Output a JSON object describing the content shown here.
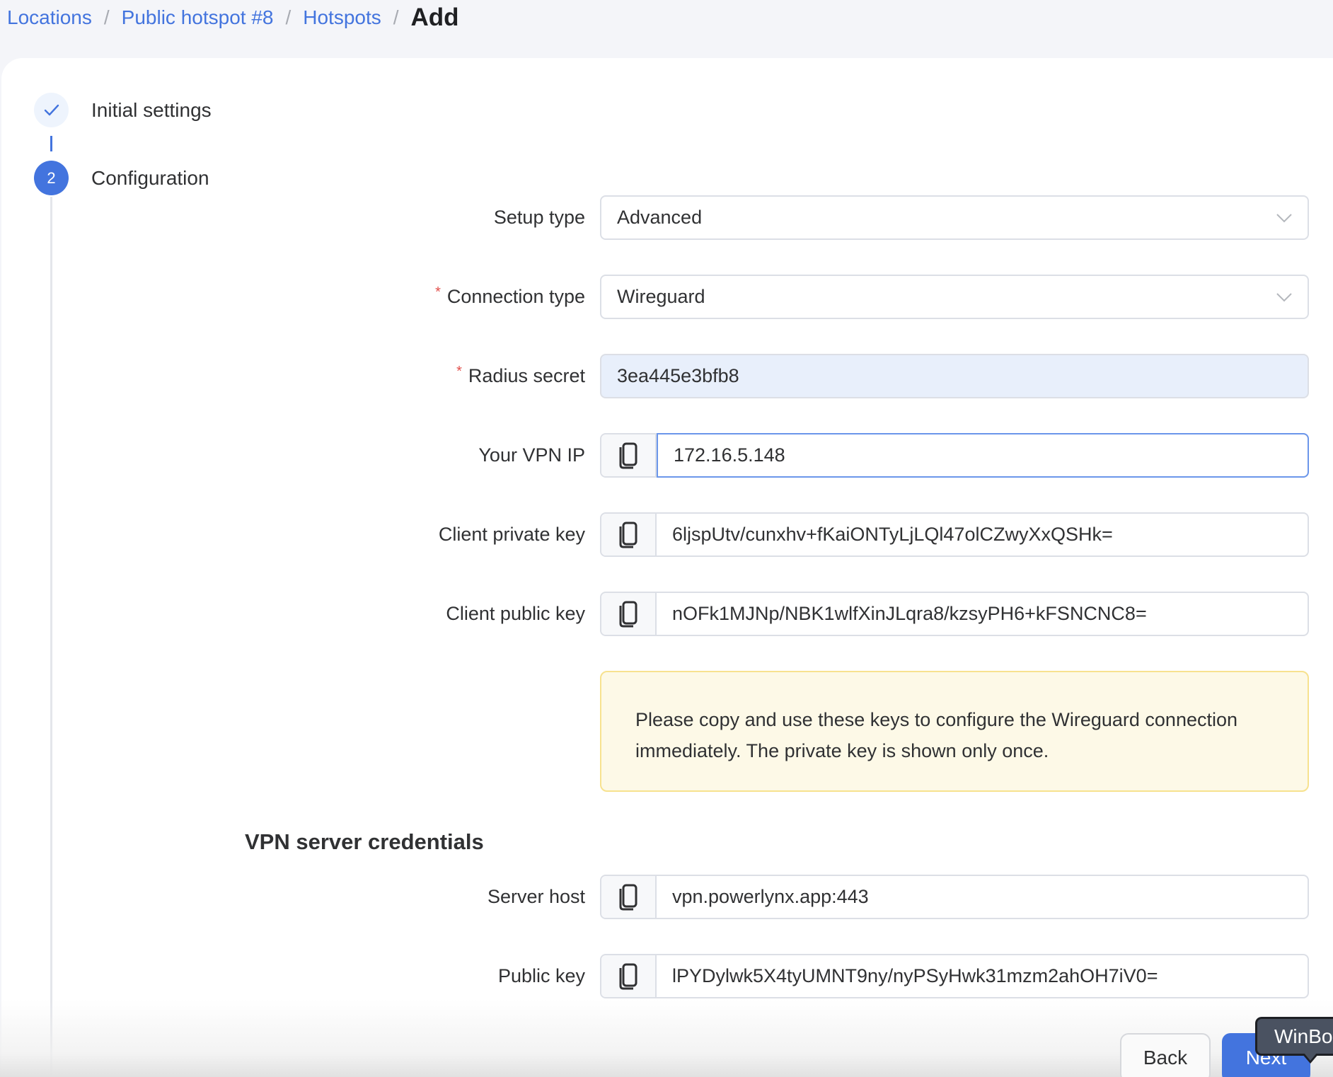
{
  "breadcrumb": {
    "items": [
      "Locations",
      "Public hotspot #8",
      "Hotspots"
    ],
    "separator": "/",
    "current": "Add"
  },
  "stepper": {
    "steps": [
      {
        "label": "Initial settings",
        "status": "done",
        "icon": "check-icon"
      },
      {
        "label": "Configuration",
        "status": "active",
        "number": "2"
      }
    ]
  },
  "form": {
    "setup_type": {
      "label": "Setup type",
      "value": "Advanced",
      "required": false
    },
    "connection_type": {
      "label": "Connection type",
      "value": "Wireguard",
      "required": true
    },
    "radius_secret": {
      "label": "Radius secret",
      "value": "3ea445e3bfb8",
      "required": true
    },
    "vpn_ip": {
      "label": "Your VPN IP",
      "value": "172.16.5.148",
      "focused": true
    },
    "client_private_key": {
      "label": "Client private key",
      "value": "6ljspUtv/cunxhv+fKaiONTyLjLQl47olCZwyXxQSHk="
    },
    "client_public_key": {
      "label": "Client public key",
      "value": "nOFk1MJNp/NBK1wlfXinJLqra8/kzsyPH6+kFSNCNC8="
    },
    "required_marker": "*",
    "copy_icon": "copy-icon"
  },
  "notice": {
    "text": "Please copy and use these keys to configure the Wireguard connection immediately. The private key is shown only once."
  },
  "server_credentials": {
    "title": "VPN server credentials",
    "server_host": {
      "label": "Server host",
      "value": "vpn.powerlynx.app:443"
    },
    "public_key": {
      "label": "Public key",
      "value": "lPYDylwk5X4tyUMNT9ny/nyPSyHwk31mzm2ahOH7iV0="
    }
  },
  "actions": {
    "back_label": "Back",
    "next_label": "Next"
  },
  "tooltip": {
    "text": "WinBox"
  },
  "colors": {
    "accent": "#4374de",
    "required": "#e2504c",
    "notice_bg": "#fdf9e7",
    "notice_border": "#f7e28f",
    "autofill_bg": "#e8effb"
  }
}
